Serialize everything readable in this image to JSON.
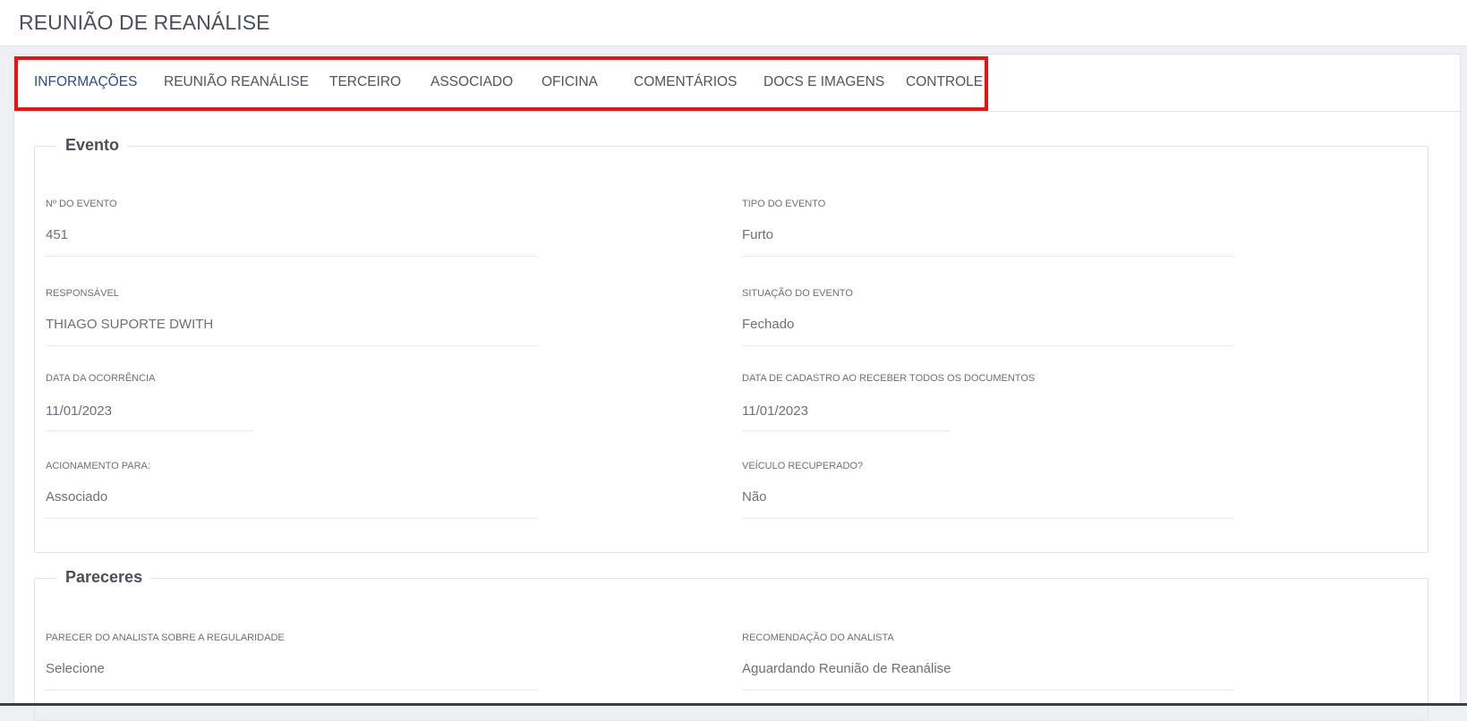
{
  "header": {
    "title": "REUNIÃO DE REANÁLISE"
  },
  "tabs": [
    {
      "label": "INFORMAÇÕES"
    },
    {
      "label": "REUNIÃO REANÁLISE"
    },
    {
      "label": "TERCEIRO"
    },
    {
      "label": "ASSOCIADO"
    },
    {
      "label": "OFICINA"
    },
    {
      "label": "COMENTÁRIOS"
    },
    {
      "label": "DOCS E IMAGENS"
    },
    {
      "label": "CONTROLE"
    }
  ],
  "active_tab": "INFORMAÇÕES",
  "highlight_color": "#ee1111",
  "evento": {
    "legend": "Evento",
    "numero": {
      "label": "Nº DO EVENTO",
      "value": "451"
    },
    "tipo": {
      "label": "TIPO DO EVENTO",
      "value": "Furto"
    },
    "responsavel": {
      "label": "RESPONSÁVEL",
      "value": "THIAGO SUPORTE DWITH"
    },
    "situacao": {
      "label": "SITUAÇÃO DO EVENTO",
      "value": "Fechado"
    },
    "data_ocorrencia": {
      "label": "DATA DA OCORRÊNCIA",
      "value": "11/01/2023"
    },
    "data_cadastro": {
      "label": "DATA DE CADASTRO AO RECEBER TODOS OS DOCUMENTOS",
      "value": "11/01/2023"
    },
    "acionamento": {
      "label": "ACIONAMENTO PARA:",
      "value": "Associado"
    },
    "veiculo_recuperado": {
      "label": "VEÍCULO RECUPERADO?",
      "value": "Não"
    }
  },
  "pareceres": {
    "legend": "Pareceres",
    "parecer_analista": {
      "label": "PARECER DO ANALISTA SOBRE A REGULARIDADE",
      "value": "Selecione"
    },
    "recomendacao": {
      "label": "RECOMENDAÇÃO DO ANALISTA",
      "value": "Aguardando Reunião de Reanálise"
    }
  }
}
